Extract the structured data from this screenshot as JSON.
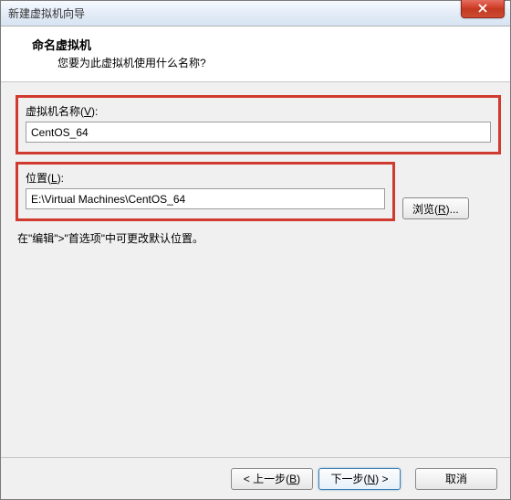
{
  "window": {
    "title": "新建虚拟机向导"
  },
  "header": {
    "title": "命名虚拟机",
    "subtitle": "您要为此虚拟机使用什么名称?"
  },
  "fields": {
    "name": {
      "label_before": "虚拟机名称(",
      "accel": "V",
      "label_after": "):",
      "value": "CentOS_64"
    },
    "location": {
      "label_before": "位置(",
      "accel": "L",
      "label_after": "):",
      "value": "E:\\Virtual Machines\\CentOS_64"
    }
  },
  "buttons": {
    "browse_before": "浏览(",
    "browse_accel": "R",
    "browse_after": ")...",
    "back_before": "< 上一步(",
    "back_accel": "B",
    "back_after": ")",
    "next_before": "下一步(",
    "next_accel": "N",
    "next_after": ") >",
    "cancel": "取消"
  },
  "hint": "在\"编辑\">\"首选项\"中可更改默认位置。"
}
